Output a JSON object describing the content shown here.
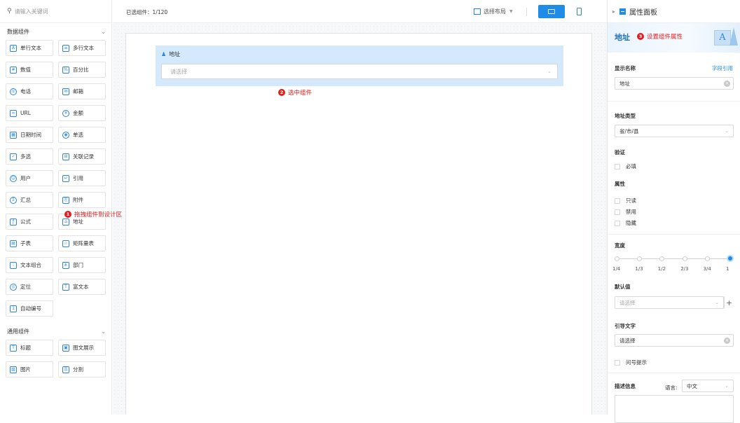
{
  "left_panel": {
    "search_placeholder": "请输入关键词",
    "group_data": "数据组件",
    "data_components": [
      {
        "label": "单行文本",
        "icon": "text-single-icon"
      },
      {
        "label": "多行文本",
        "icon": "text-multi-icon"
      },
      {
        "label": "数值",
        "icon": "number-icon"
      },
      {
        "label": "百分比",
        "icon": "percent-icon"
      },
      {
        "label": "电话",
        "icon": "phone-icon"
      },
      {
        "label": "邮箱",
        "icon": "email-icon"
      },
      {
        "label": "URL",
        "icon": "link-icon"
      },
      {
        "label": "金额",
        "icon": "money-icon"
      },
      {
        "label": "日期时间",
        "icon": "calendar-icon"
      },
      {
        "label": "单选",
        "icon": "radio-icon"
      },
      {
        "label": "多选",
        "icon": "checkbox-icon"
      },
      {
        "label": "关联记录",
        "icon": "relation-icon"
      },
      {
        "label": "用户",
        "icon": "user-icon"
      },
      {
        "label": "引用",
        "icon": "quote-icon"
      },
      {
        "label": "汇总",
        "icon": "summary-icon"
      },
      {
        "label": "附件",
        "icon": "attachment-icon"
      },
      {
        "label": "公式",
        "icon": "formula-icon"
      },
      {
        "label": "地址",
        "icon": "address-icon"
      },
      {
        "label": "子表",
        "icon": "subtable-icon"
      },
      {
        "label": "矩阵量表",
        "icon": "matrix-icon"
      },
      {
        "label": "文本组合",
        "icon": "text-combo-icon"
      },
      {
        "label": "部门",
        "icon": "department-icon"
      },
      {
        "label": "定位",
        "icon": "location-icon"
      },
      {
        "label": "富文本",
        "icon": "rich-text-icon"
      },
      {
        "label": "自动编号",
        "icon": "auto-number-icon"
      }
    ],
    "group_general": "通用组件",
    "general_components": [
      {
        "label": "标题",
        "icon": "title-icon"
      },
      {
        "label": "图文展示",
        "icon": "image-text-icon"
      },
      {
        "label": "图片",
        "icon": "image-icon"
      },
      {
        "label": "分割",
        "icon": "divider-icon"
      }
    ]
  },
  "topbar": {
    "selected_count": "已选组件：1/120",
    "layout_select": "选择布局"
  },
  "canvas": {
    "field_label": "地址",
    "field_placeholder": "请选择"
  },
  "annotations": [
    {
      "num": "1",
      "text": "拖拽组件到设计区"
    },
    {
      "num": "2",
      "text": "选中组件"
    },
    {
      "num": "3",
      "text": "设置组件属性"
    }
  ],
  "right_panel": {
    "title": "属性面板",
    "component_name": "地址",
    "display_name_label": "显示名称",
    "field_ref_link": "字段引用",
    "display_name_value": "地址",
    "address_type_label": "地址类型",
    "address_type_value": "省/市/县",
    "validation_label": "验证",
    "required_label": "必填",
    "attributes_label": "属性",
    "readonly_label": "只读",
    "disabled_label": "禁用",
    "hidden_label": "隐藏",
    "width_label": "宽度",
    "width_ticks": [
      "1/4",
      "1/3",
      "1/2",
      "2/3",
      "3/4",
      "1"
    ],
    "width_selected": "1",
    "default_label": "默认值",
    "default_placeholder": "请选择",
    "guide_label": "引导文字",
    "guide_value": "请选择",
    "question_tip_label": "问号提示",
    "desc_label": "描述信息",
    "lang_label": "语言:",
    "lang_value": "中文"
  },
  "colors": {
    "accent": "#1f8ce8",
    "annotation": "#e02020",
    "selected_field_bg": "#d4e9fb"
  }
}
